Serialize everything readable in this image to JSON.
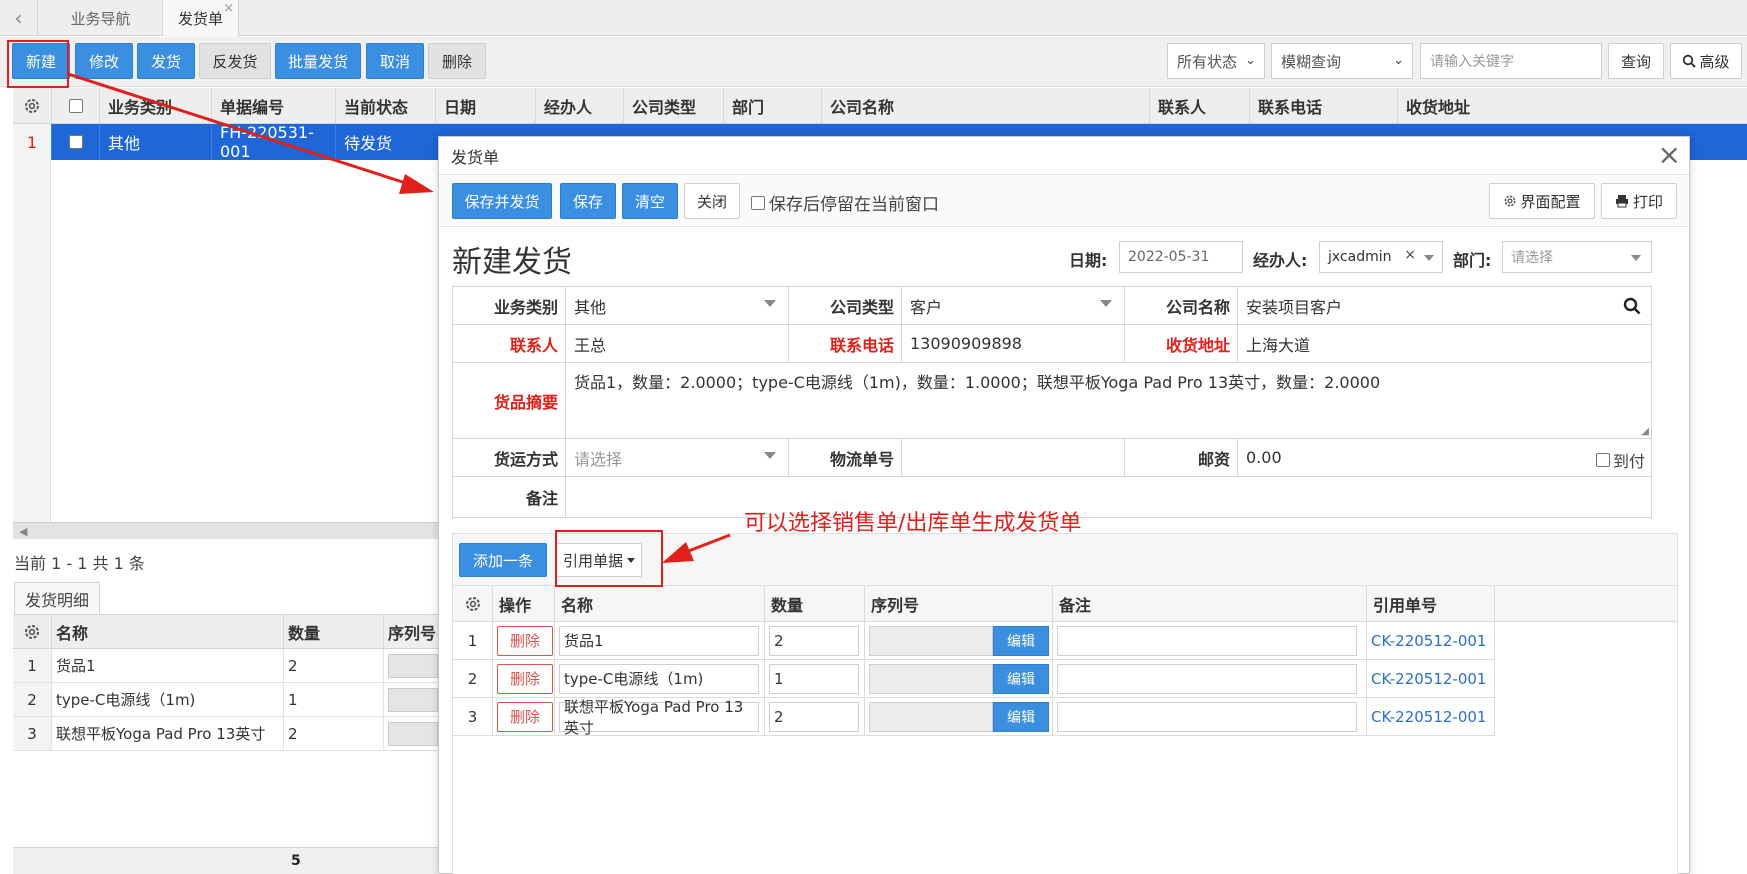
{
  "tabs": [
    {
      "label": "业务导航"
    },
    {
      "label": "发货单",
      "close": "×"
    }
  ],
  "nav": {
    "back": "‹"
  },
  "toolbar": {
    "new": "新建",
    "edit": "修改",
    "ship": "发货",
    "unship": "反发货",
    "batch_ship": "批量发货",
    "cancel": "取消",
    "delete": "删除",
    "status_filter": "所有状态",
    "query_mode": "模糊查询",
    "keyword_placeholder": "请输入关键字",
    "search": "查询",
    "advanced": "高级"
  },
  "grid": {
    "columns": [
      "业务类别",
      "单据编号",
      "当前状态",
      "日期",
      "经办人",
      "公司类型",
      "部门",
      "公司名称",
      "联系人",
      "联系电话",
      "收货地址"
    ],
    "rows": [
      {
        "num": "1",
        "category": "其他",
        "code": "FH-220531-001",
        "status": "待发货"
      }
    ]
  },
  "pager": {
    "text": "当前 1 - 1 共 1 条"
  },
  "detail": {
    "tab": "发货明细",
    "columns": [
      "名称",
      "数量",
      "序列号"
    ],
    "rows": [
      {
        "num": "1",
        "name": "货品1",
        "qty": "2"
      },
      {
        "num": "2",
        "name": "type-C电源线（1m)",
        "qty": "1"
      },
      {
        "num": "3",
        "name": "联想平板Yoga Pad Pro 13英寸",
        "qty": "2"
      }
    ],
    "total_qty": "5"
  },
  "dialog": {
    "title": "发货单",
    "close": "×",
    "buttons": {
      "save_ship": "保存并发货",
      "save": "保存",
      "clear": "清空",
      "close": "关闭",
      "ui_config": "界面配置",
      "print": "打印"
    },
    "stay_label": "保存后停留在当前窗口",
    "form_title": "新建发货",
    "date_label": "日期:",
    "date_value": "2022-05-31",
    "handler_label": "经办人:",
    "handler_value": "jxcadmin",
    "handler_clear": "×",
    "dept_label": "部门:",
    "dept_placeholder": "请选择",
    "fields": {
      "category_label": "业务类别",
      "category_value": "其他",
      "company_type_label": "公司类型",
      "company_type_value": "客户",
      "company_name_label": "公司名称",
      "company_name_value": "安装项目客户",
      "contact_label": "联系人",
      "contact_value": "王总",
      "phone_label": "联系电话",
      "phone_value": "13090909898",
      "address_label": "收货地址",
      "address_value": "上海大道",
      "summary_label": "货品摘要",
      "summary_value": "货品1，数量：2.0000；type-C电源线（1m)，数量：1.0000；联想平板Yoga Pad Pro 13英寸，数量：2.0000",
      "shipping_label": "货运方式",
      "shipping_placeholder": "请选择",
      "tracking_label": "物流单号",
      "tracking_value": "",
      "postage_label": "邮资",
      "postage_value": "0.00",
      "cod_label": "到付",
      "remark_label": "备注",
      "remark_value": ""
    },
    "sub": {
      "add": "添加一条",
      "ref": "引用单据",
      "columns": [
        "操作",
        "名称",
        "数量",
        "序列号",
        "备注",
        "引用单号"
      ],
      "rows": [
        {
          "num": "1",
          "del": "删除",
          "name": "货品1",
          "qty": "2",
          "edit": "编辑",
          "remark": "",
          "ref": "CK-220512-001"
        },
        {
          "num": "2",
          "del": "删除",
          "name": "type-C电源线（1m)",
          "qty": "1",
          "edit": "编辑",
          "remark": "",
          "ref": "CK-220512-001"
        },
        {
          "num": "3",
          "del": "删除",
          "name": "联想平板Yoga Pad Pro 13英寸",
          "qty": "2",
          "edit": "编辑",
          "remark": "",
          "ref": "CK-220512-001"
        }
      ]
    }
  },
  "annotation": {
    "text": "可以选择销售单/出库单生成发货单",
    "color": "#e0201b"
  },
  "colors": {
    "primary": "#3b8fe0",
    "selected_row": "#1f67d6",
    "required": "#e0201b",
    "link": "#2a6fc9"
  }
}
